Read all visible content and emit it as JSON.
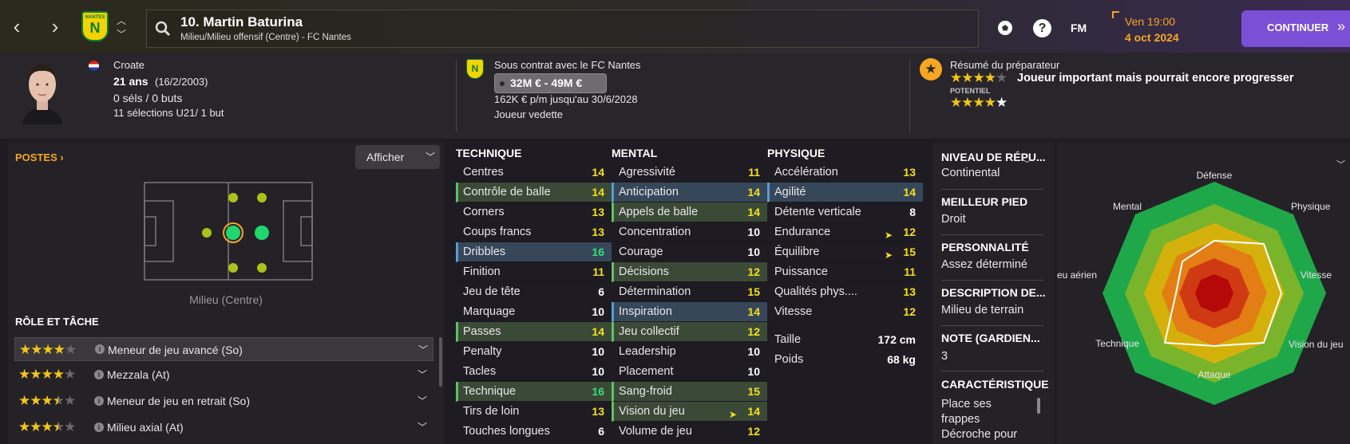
{
  "header": {
    "player_title": "10. Martin Baturina",
    "player_subtitle": "Milieu/Milieu offensif (Centre) - FC Nantes",
    "badge_short": "NANTES",
    "badge_letter": "N",
    "fm_label": "FM",
    "date_day": "Ven 19:00",
    "date": "4 oct 2024",
    "continue_label": "CONTINUER"
  },
  "profile": {
    "nationality": "Croate",
    "age": "21 ans",
    "birthdate": "(16/2/2003)",
    "caps": "0 séls / 0 buts",
    "youth_caps": "11 sélections U21/ 1 but"
  },
  "contract": {
    "title": "Sous contrat avec le FC Nantes",
    "value": "32M € - 49M €",
    "wage": "162K € p/m jusqu'au 30/6/2028",
    "status": "Joueur vedette"
  },
  "scout": {
    "title": "Résumé du préparateur",
    "summary": "Joueur important mais pourrait encore progresser",
    "potential_label": "POTENTIEL",
    "current_stars": 3.5,
    "potential_stars": 4.5
  },
  "positions": {
    "title": "POSTES",
    "show_button": "Afficher",
    "position_label": "Milieu (Centre)"
  },
  "roles": {
    "title": "RÔLE ET TÂCHE",
    "items": [
      {
        "name": "Meneur de jeu avancé (So)",
        "stars": 4
      },
      {
        "name": "Mezzala (At)",
        "stars": 4
      },
      {
        "name": "Meneur de jeu en retrait (So)",
        "stars": 3.5
      },
      {
        "name": "Milieu axial (At)",
        "stars": 3.5
      }
    ]
  },
  "technique": {
    "title": "TECHNIQUE",
    "rows": [
      {
        "label": "Centres",
        "value": "14"
      },
      {
        "label": "Contrôle de balle",
        "value": "14"
      },
      {
        "label": "Corners",
        "value": "13"
      },
      {
        "label": "Coups francs",
        "value": "13"
      },
      {
        "label": "Dribbles",
        "value": "16"
      },
      {
        "label": "Finition",
        "value": "11"
      },
      {
        "label": "Jeu de tête",
        "value": "6"
      },
      {
        "label": "Marquage",
        "value": "10"
      },
      {
        "label": "Passes",
        "value": "14"
      },
      {
        "label": "Penalty",
        "value": "10"
      },
      {
        "label": "Tacles",
        "value": "10"
      },
      {
        "label": "Technique",
        "value": "16"
      },
      {
        "label": "Tirs de loin",
        "value": "13"
      },
      {
        "label": "Touches longues",
        "value": "6"
      }
    ]
  },
  "mental": {
    "title": "MENTAL",
    "rows": [
      {
        "label": "Agressivité",
        "value": "11"
      },
      {
        "label": "Anticipation",
        "value": "14"
      },
      {
        "label": "Appels de balle",
        "value": "14"
      },
      {
        "label": "Concentration",
        "value": "10"
      },
      {
        "label": "Courage",
        "value": "10"
      },
      {
        "label": "Décisions",
        "value": "12"
      },
      {
        "label": "Détermination",
        "value": "15"
      },
      {
        "label": "Inspiration",
        "value": "14"
      },
      {
        "label": "Jeu collectif",
        "value": "12"
      },
      {
        "label": "Leadership",
        "value": "10"
      },
      {
        "label": "Placement",
        "value": "10"
      },
      {
        "label": "Sang-froid",
        "value": "15"
      },
      {
        "label": "Vision du jeu",
        "value": "14"
      },
      {
        "label": "Volume de jeu",
        "value": "12"
      }
    ]
  },
  "physique": {
    "title": "PHYSIQUE",
    "rows": [
      {
        "label": "Accélération",
        "value": "13"
      },
      {
        "label": "Agilité",
        "value": "14"
      },
      {
        "label": "Détente verticale",
        "value": "8"
      },
      {
        "label": "Endurance",
        "value": "12"
      },
      {
        "label": "Équilibre",
        "value": "15"
      },
      {
        "label": "Puissance",
        "value": "11"
      },
      {
        "label": "Qualités phys....",
        "value": "13"
      },
      {
        "label": "Vitesse",
        "value": "12"
      }
    ],
    "height_label": "Taille",
    "height": "172 cm",
    "weight_label": "Poids",
    "weight": "68 kg"
  },
  "side": {
    "reputation_h": "NIVEAU DE RÉPU...",
    "reputation": "Continental",
    "foot_h": "MEILLEUR PIED",
    "foot": "Droit",
    "personality_h": "PERSONNALITÉ",
    "personality": "Assez déterminé",
    "desc_h": "DESCRIPTION DE...",
    "desc": "Milieu de terrain",
    "rating_h": "NOTE (GARDIEN...",
    "rating": "3",
    "trait_h": "CARACTÉRISTIQUE",
    "trait_1": "Place ses",
    "trait_2": "frappes",
    "trait_3": "Décroche pour"
  },
  "radar": {
    "labels": [
      "Défense",
      "Physique",
      "Vitesse",
      "Vision du jeu",
      "Attaque",
      "Technique",
      "Jeu aérien",
      "Mental"
    ]
  },
  "colors": {
    "accent": "#7b4fd6",
    "star": "#f5c518",
    "value_yellow": "#f5e21d",
    "value_green": "#35e07a",
    "orange": "#f5a623"
  }
}
